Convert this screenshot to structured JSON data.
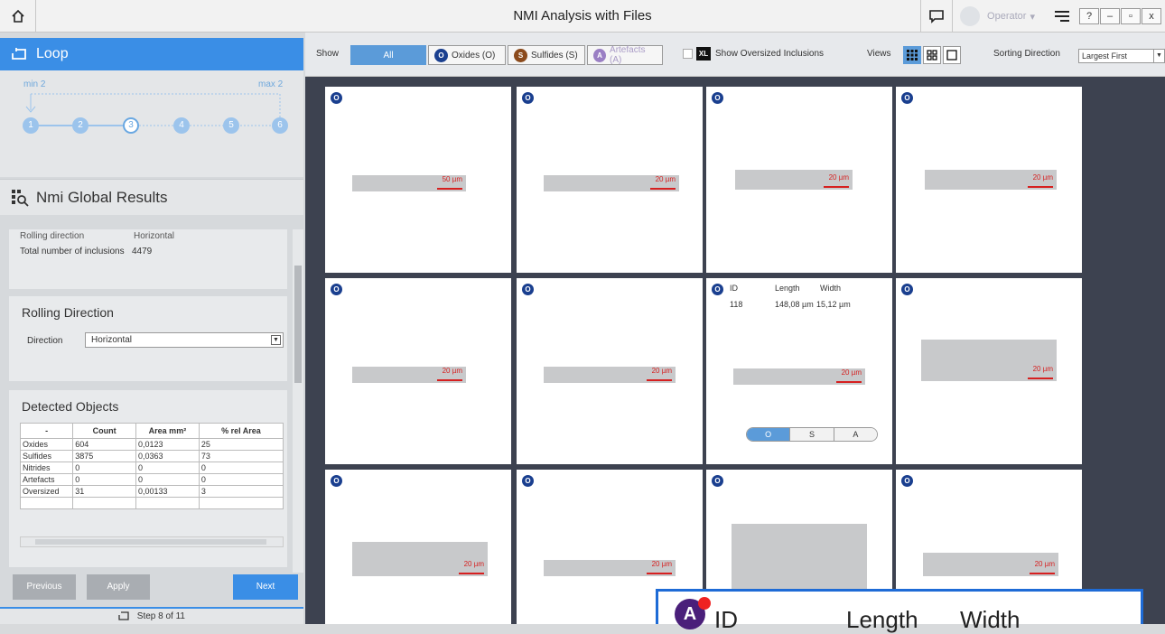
{
  "title_bar": {
    "title": "NMI Analysis with Files",
    "operator": "Operator",
    "operator_caret": "▾",
    "window_buttons": [
      "?",
      "–",
      "▫",
      "x"
    ]
  },
  "left_panel": {
    "loop": {
      "title": "Loop",
      "min_label": "min 2",
      "max_label": "max 2",
      "steps": [
        "1",
        "2",
        "3",
        "4",
        "5",
        "6"
      ],
      "active_step": "3"
    },
    "nmi_results_title": "Nmi Global Results",
    "info": [
      {
        "label": "Rolling direction",
        "value": "Horizontal"
      },
      {
        "label": "Total number of inclusions",
        "value": "4479"
      }
    ],
    "rolling": {
      "title": "Rolling Direction",
      "label": "Direction",
      "value": "Horizontal"
    },
    "detected": {
      "title": "Detected Objects",
      "headers": [
        "-",
        "Count",
        "Area mm²",
        "% rel Area"
      ],
      "rows": [
        [
          "Oxides",
          "604",
          "0,0123",
          "25"
        ],
        [
          "Sulfides",
          "3875",
          "0,0363",
          "73"
        ],
        [
          "Nitrides",
          "0",
          "0",
          "0"
        ],
        [
          "Artefacts",
          "0",
          "0",
          "0"
        ],
        [
          "Oversized",
          "31",
          "0,00133",
          "3"
        ]
      ]
    },
    "buttons": {
      "previous": "Previous",
      "apply": "Apply",
      "next": "Next"
    },
    "step_footer": "Step 8 of 11"
  },
  "toolbar": {
    "show_label": "Show",
    "filters": {
      "all": "All",
      "oxides": "Oxides (O)",
      "sulfides": "Sulfides (S)",
      "artefacts": "Artefacts (A)"
    },
    "badges": {
      "oxides": "O",
      "sulfides": "S",
      "artefacts": "A"
    },
    "oversized_label": "Show Oversized Inclusions",
    "xl": "XL",
    "views_label": "Views",
    "sorting_label": "Sorting Direction",
    "sorting_value": "Largest First"
  },
  "tiles": [
    {
      "badge": "O",
      "scale": "50 µm"
    },
    {
      "badge": "O",
      "scale": "20 µm"
    },
    {
      "badge": "O",
      "scale": "20 µm"
    },
    {
      "badge": "O",
      "scale": "20 µm"
    },
    {
      "badge": "O",
      "scale": "20 µm"
    },
    {
      "badge": "O",
      "scale": "20 µm"
    },
    {
      "badge": "O",
      "scale": "20 µm"
    },
    {
      "badge": "O",
      "scale": "20 µm"
    },
    {
      "badge": "O",
      "scale": "20 µm"
    },
    {
      "badge": "O",
      "scale": "20 µm"
    },
    {
      "badge": "O",
      "scale": ""
    },
    {
      "badge": "O",
      "scale": "20 µm"
    }
  ],
  "hover_info": {
    "id_label": "ID",
    "length_label": "Length",
    "width_label": "Width",
    "id": "118",
    "length": "148,08 µm",
    "width": "15,12 µm",
    "classes": [
      "O",
      "S",
      "A"
    ]
  },
  "callout": {
    "badge": "A",
    "id_label": "ID",
    "length_label": "Length",
    "width_label": "Width"
  },
  "colors": {
    "accent": "#3a8ee6",
    "oxide": "#1a3f8f",
    "sulfide": "#8b4a1c",
    "artefact": "#9a7fc4",
    "scale": "#d62020",
    "grid_bg": "#3d4250"
  }
}
